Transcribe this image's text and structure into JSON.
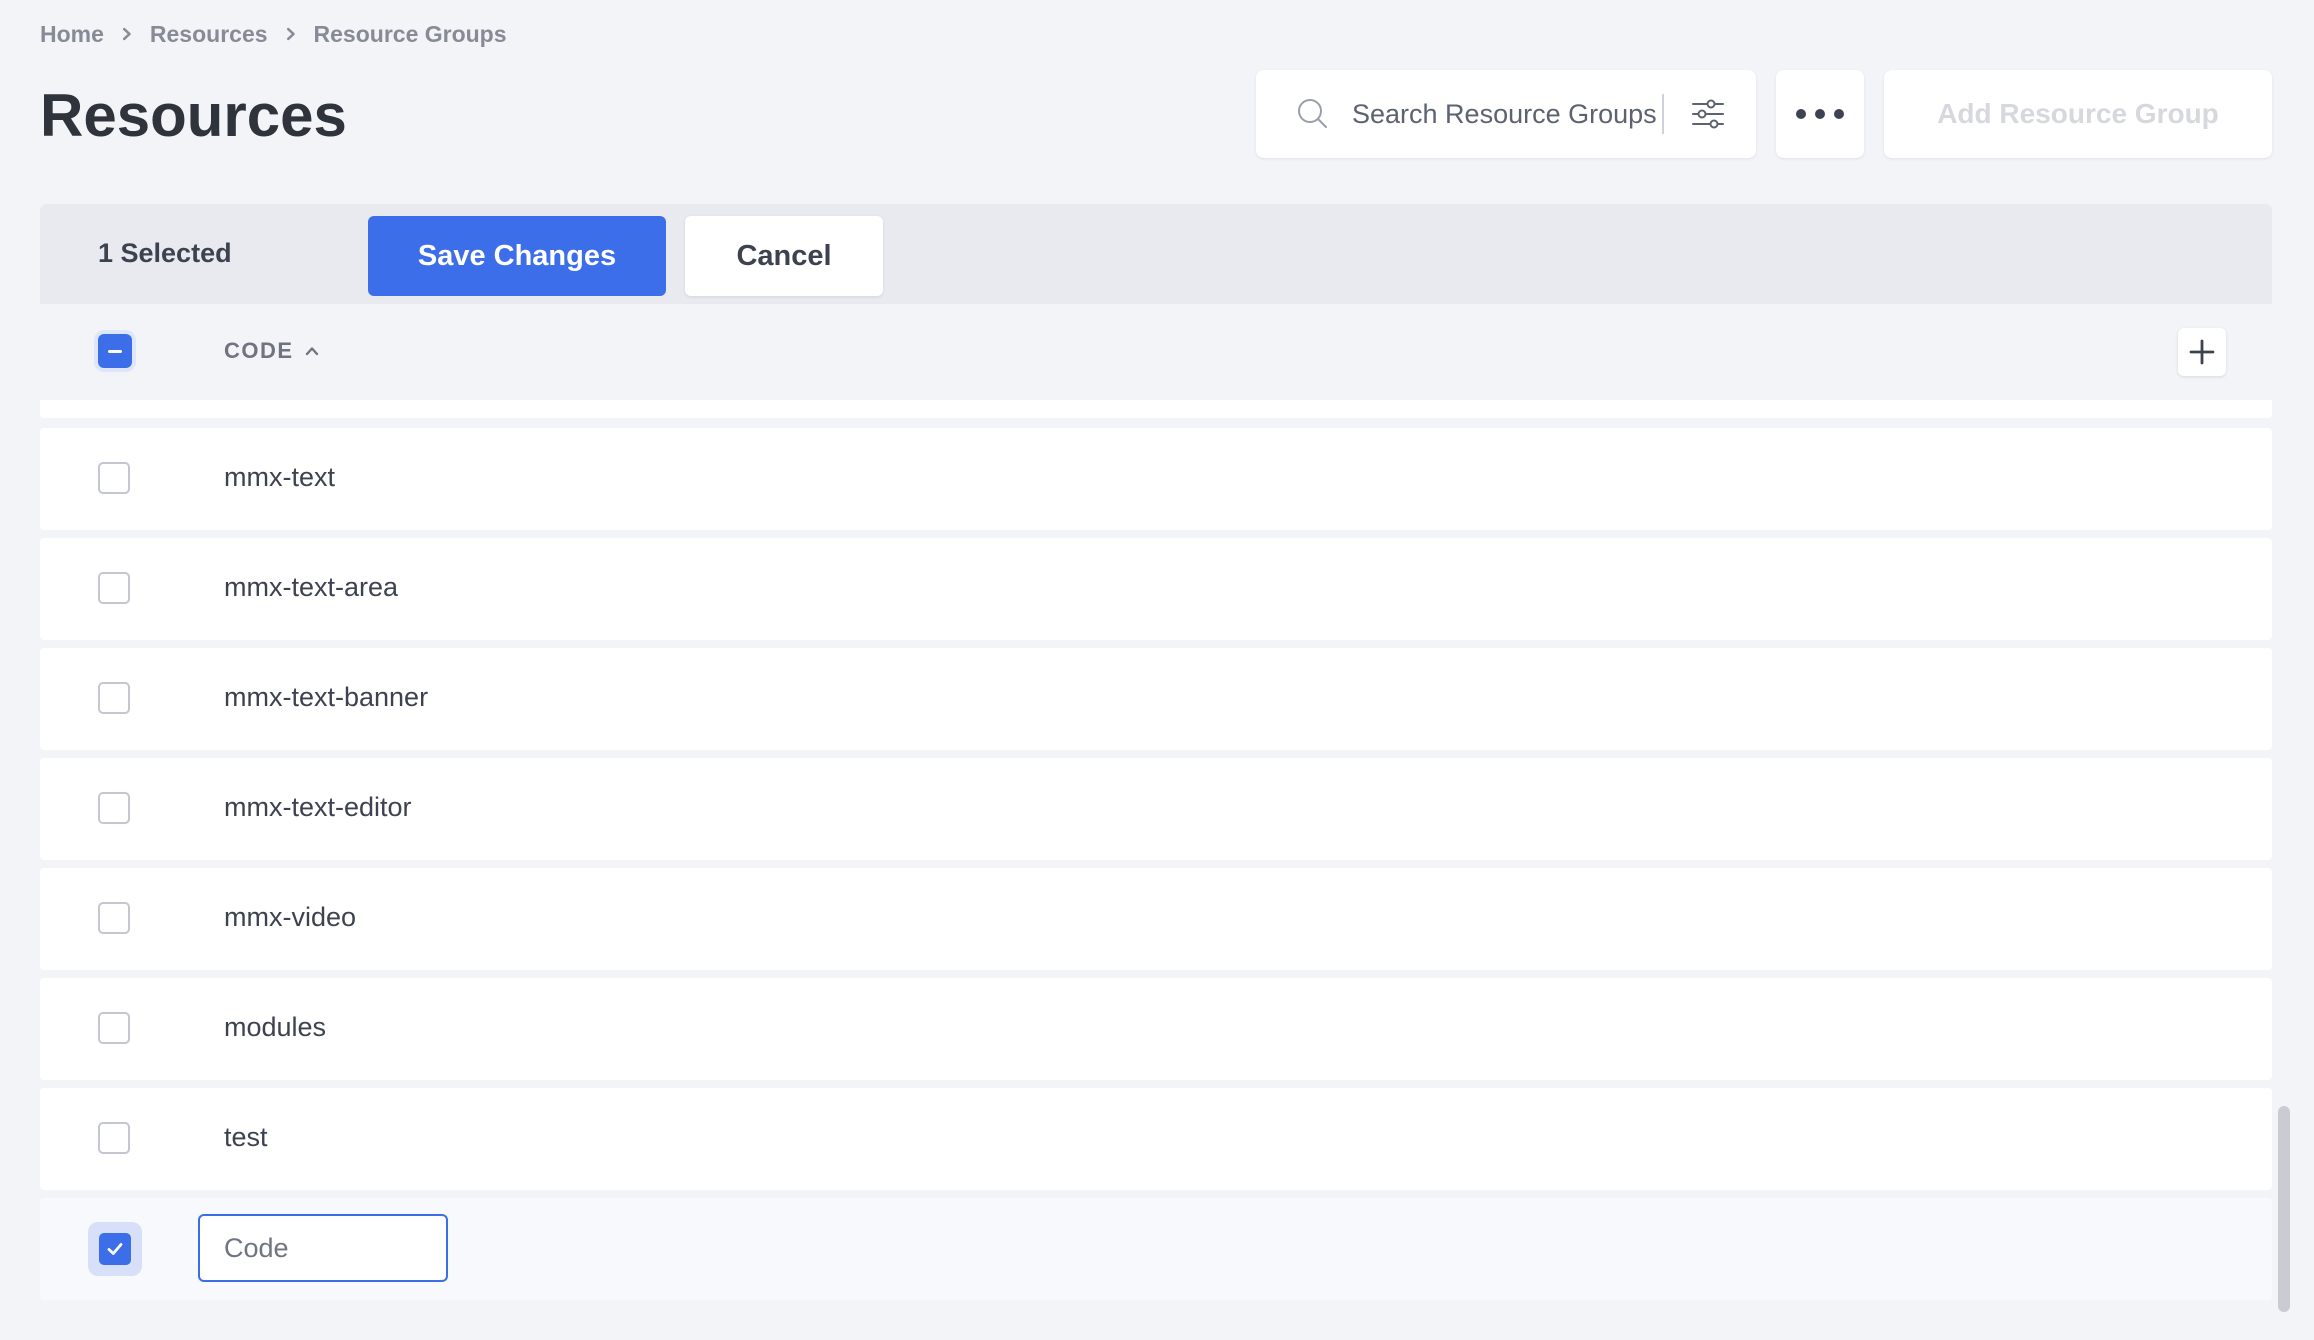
{
  "breadcrumb": [
    "Home",
    "Resources",
    "Resource Groups"
  ],
  "page_title": "Resources",
  "search": {
    "placeholder": "Search Resource Groups"
  },
  "header": {
    "add_button_label": "Add Resource Group"
  },
  "selection_bar": {
    "selected_label": "1 Selected",
    "save_label": "Save Changes",
    "cancel_label": "Cancel"
  },
  "table": {
    "column_code": "CODE",
    "sort_direction": "ascending",
    "rows": [
      {
        "code": "mmx-text",
        "checked": false
      },
      {
        "code": "mmx-text-area",
        "checked": false
      },
      {
        "code": "mmx-text-banner",
        "checked": false
      },
      {
        "code": "mmx-text-editor",
        "checked": false
      },
      {
        "code": "mmx-video",
        "checked": false
      },
      {
        "code": "modules",
        "checked": false
      },
      {
        "code": "test",
        "checked": false
      }
    ],
    "new_row": {
      "checked": true,
      "code_value": "",
      "code_placeholder": "Code"
    }
  },
  "colors": {
    "accent": "#3d6eea",
    "background": "#f3f4f8",
    "disabled_text": "#d6d8de"
  },
  "icons": {
    "search": "search-icon",
    "filter": "filter-sliders-icon",
    "more": "more-dots-icon",
    "sort": "chevron-up-icon",
    "add_column": "plus-icon",
    "breadcrumb_separator": "chevron-right-icon",
    "check": "check-icon"
  }
}
